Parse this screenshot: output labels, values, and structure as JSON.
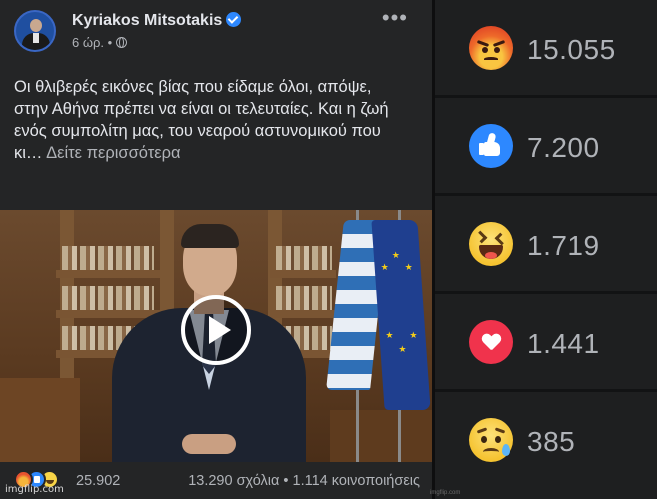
{
  "post": {
    "author": "Kyriakos Mitsotakis",
    "time": "6 ώρ. •",
    "text": "Οι θλιβερές εικόνες βίας που είδαμε όλοι, απόψε, στην Αθήνα πρέπει να είναι οι τελευταίες. Και η ζωή ενός συμπολίτη μας, του νεαρού αστυνομικού που κι…",
    "see_more": "Δείτε περισσότερα",
    "reaction_total": "25.902",
    "engagement": "13.290 σχόλια • 1.114 κοινοποιήσεις"
  },
  "reactions": [
    {
      "type": "angry",
      "icon": "angry-icon",
      "count": "15.055"
    },
    {
      "type": "like",
      "icon": "like-icon",
      "count": "7.200"
    },
    {
      "type": "haha",
      "icon": "haha-icon",
      "count": "1.719"
    },
    {
      "type": "love",
      "icon": "love-icon",
      "count": "1.441"
    },
    {
      "type": "sad",
      "icon": "sad-icon",
      "count": "385"
    }
  ],
  "watermarks": {
    "left": "imgflip.com",
    "right": "imgflip.com"
  },
  "colors": {
    "background": "#242526",
    "primary_text": "#e4e6eb",
    "secondary_text": "#b0b3b8",
    "verified_blue": "#2d88ff"
  }
}
